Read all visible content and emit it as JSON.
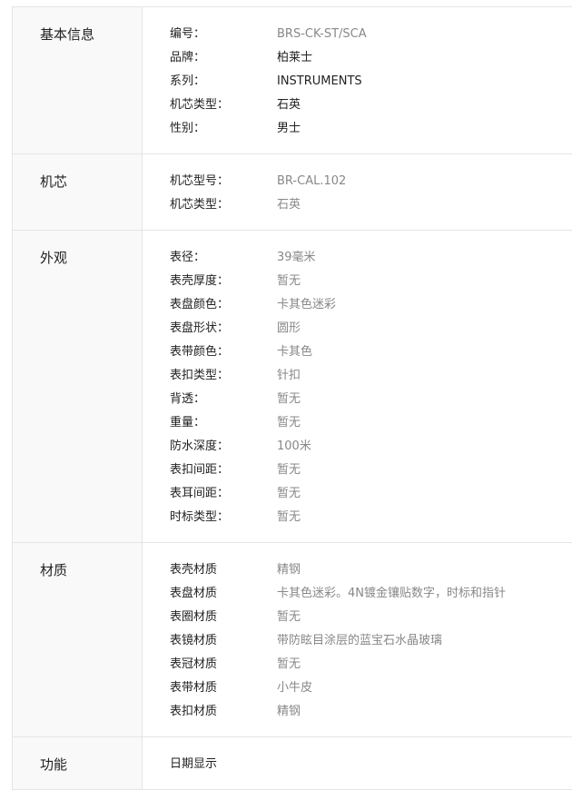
{
  "sections": [
    {
      "title": "基本信息",
      "rows": [
        {
          "label": "编号：",
          "value": "BRS-CK-ST/SCA",
          "dark": false
        },
        {
          "label": "品牌：",
          "value": "柏莱士",
          "dark": true
        },
        {
          "label": "系列：",
          "value": "INSTRUMENTS",
          "dark": true
        },
        {
          "label": "机芯类型：",
          "value": "石英",
          "dark": true
        },
        {
          "label": "性别：",
          "value": "男士",
          "dark": true
        }
      ]
    },
    {
      "title": "机芯",
      "rows": [
        {
          "label": "机芯型号：",
          "value": "BR-CAL.102"
        },
        {
          "label": "机芯类型：",
          "value": "石英"
        }
      ]
    },
    {
      "title": "外观",
      "rows": [
        {
          "label": "表径：",
          "value": "39毫米"
        },
        {
          "label": "表壳厚度：",
          "value": "暂无"
        },
        {
          "label": "表盘颜色：",
          "value": "卡其色迷彩"
        },
        {
          "label": "表盘形状：",
          "value": "圆形"
        },
        {
          "label": "表带颜色：",
          "value": "卡其色"
        },
        {
          "label": "表扣类型：",
          "value": "针扣"
        },
        {
          "label": "背透：",
          "value": "暂无"
        },
        {
          "label": "重量：",
          "value": "暂无"
        },
        {
          "label": "防水深度：",
          "value": "100米"
        },
        {
          "label": "表扣间距：",
          "value": "暂无"
        },
        {
          "label": "表耳间距：",
          "value": "暂无"
        },
        {
          "label": "时标类型：",
          "value": "暂无"
        }
      ]
    },
    {
      "title": "材质",
      "rows": [
        {
          "label": "表壳材质",
          "value": "精钢"
        },
        {
          "label": "表盘材质",
          "value": "卡其色迷彩。4N镀金镶贴数字，时标和指针"
        },
        {
          "label": "表圈材质",
          "value": "暂无"
        },
        {
          "label": "表镜材质",
          "value": "带防眩目涂层的蓝宝石水晶玻璃"
        },
        {
          "label": "表冠材质",
          "value": "暂无"
        },
        {
          "label": "表带材质",
          "value": "小牛皮"
        },
        {
          "label": "表扣材质",
          "value": "精钢"
        }
      ]
    },
    {
      "title": "功能",
      "rows": [
        {
          "label": "日期显示",
          "value": ""
        }
      ]
    }
  ]
}
